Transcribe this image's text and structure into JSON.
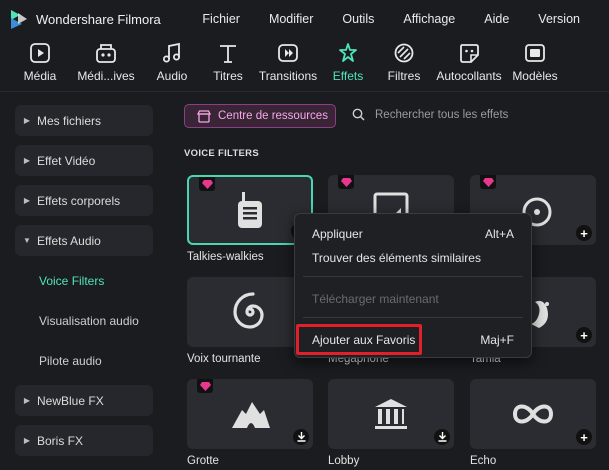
{
  "app": {
    "name": "Wondershare Filmora"
  },
  "menu": [
    "Fichier",
    "Modifier",
    "Outils",
    "Affichage",
    "Aide",
    "Version"
  ],
  "toolbar": [
    {
      "label": "Média",
      "icon": "media-icon"
    },
    {
      "label": "Médi...ives",
      "icon": "stock-media-icon"
    },
    {
      "label": "Audio",
      "icon": "music-note-icon"
    },
    {
      "label": "Titres",
      "icon": "text-icon"
    },
    {
      "label": "Transitions",
      "icon": "transition-icon"
    },
    {
      "label": "Effets",
      "icon": "effects-icon",
      "active": true
    },
    {
      "label": "Filtres",
      "icon": "filter-icon"
    },
    {
      "label": "Autocollants",
      "icon": "sticker-icon"
    },
    {
      "label": "Modèles",
      "icon": "template-icon"
    }
  ],
  "sidebar": {
    "items": [
      {
        "label": "Mes fichiers",
        "expanded": false
      },
      {
        "label": "Effet Vidéo",
        "expanded": false
      },
      {
        "label": "Effets corporels",
        "expanded": false
      },
      {
        "label": "Effets Audio",
        "expanded": true
      },
      {
        "label": "NewBlue FX",
        "expanded": false
      },
      {
        "label": "Boris FX",
        "expanded": false
      }
    ],
    "subitems": [
      {
        "label": "Voice Filters",
        "active": true
      },
      {
        "label": "Visualisation audio",
        "active": false
      },
      {
        "label": "Pilote audio",
        "active": false
      }
    ]
  },
  "main": {
    "resource_button": "Centre de ressources",
    "search_placeholder": "Rechercher tous les effets",
    "section_title": "VOICE FILTERS",
    "cards": [
      {
        "label": "Talkies-walkies",
        "icon": "walkie-talkie-icon",
        "premium": true,
        "selected": true,
        "action": "download"
      },
      {
        "label": "",
        "icon": "document-icon",
        "premium": true,
        "action": ""
      },
      {
        "label": "",
        "icon": "record-player-icon",
        "premium": true,
        "action": "add"
      },
      {
        "label": "Voix tournante",
        "icon": "spiral-icon",
        "premium": false,
        "action": ""
      },
      {
        "label": "Mégaphone",
        "icon": "megaphone-icon",
        "premium": false,
        "action": ""
      },
      {
        "label": "Tamia",
        "icon": "squirrel-icon",
        "premium": false,
        "action": "add"
      },
      {
        "label": "Grotte",
        "icon": "cave-icon",
        "premium": true,
        "action": "download"
      },
      {
        "label": "Lobby",
        "icon": "building-icon",
        "premium": false,
        "action": "download"
      },
      {
        "label": "Echo",
        "icon": "infinity-icon",
        "premium": false,
        "action": "add"
      }
    ]
  },
  "context_menu": {
    "items": [
      {
        "label": "Appliquer",
        "shortcut": "Alt+A",
        "disabled": false
      },
      {
        "label": "Trouver des éléments similaires",
        "shortcut": "",
        "disabled": false
      },
      {
        "label": "Télécharger maintenant",
        "shortcut": "",
        "disabled": true
      },
      {
        "label": "Ajouter aux Favoris",
        "shortcut": "Maj+F",
        "disabled": false
      }
    ]
  },
  "colors": {
    "accent": "#4ee3bb",
    "premium": "#e8378f",
    "highlight": "#e0202a"
  }
}
